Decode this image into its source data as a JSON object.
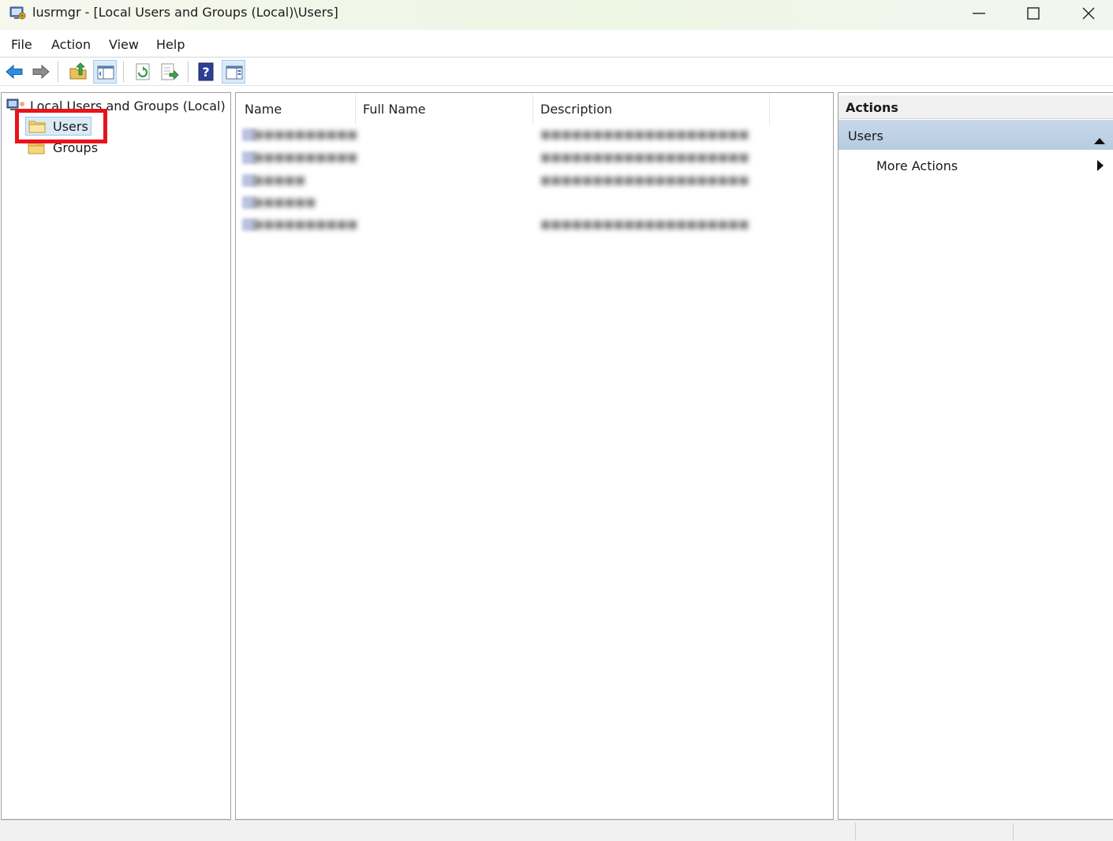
{
  "window": {
    "title": "lusrmgr - [Local Users and Groups (Local)\\Users]",
    "app_icon": "computer-management-icon"
  },
  "menubar": {
    "items": [
      {
        "label": "File"
      },
      {
        "label": "Action"
      },
      {
        "label": "View"
      },
      {
        "label": "Help"
      }
    ]
  },
  "toolbar": {
    "buttons": [
      {
        "icon": "back-arrow-icon"
      },
      {
        "icon": "forward-arrow-icon"
      },
      {
        "icon": "up-folder-icon"
      },
      {
        "icon": "show-hide-console-tree-icon",
        "selected": true
      },
      {
        "icon": "refresh-icon"
      },
      {
        "icon": "export-list-icon"
      },
      {
        "icon": "help-icon"
      },
      {
        "icon": "show-hide-action-pane-icon",
        "selected": true
      }
    ]
  },
  "tree": {
    "root": {
      "label": "Local Users and Groups (Local)",
      "icon": "computer-users-icon"
    },
    "nodes": [
      {
        "label": "Users",
        "icon": "folder-open-icon",
        "selected": true
      },
      {
        "label": "Groups",
        "icon": "folder-icon",
        "selected": false
      }
    ]
  },
  "list": {
    "columns": [
      {
        "label": "Name"
      },
      {
        "label": "Full Name"
      },
      {
        "label": "Description"
      }
    ],
    "rows_blurred": true
  },
  "actions": {
    "title": "Actions",
    "section": {
      "label": "Users",
      "expanded": true
    },
    "items": [
      {
        "label": "More Actions",
        "has_submenu": true
      }
    ]
  },
  "colors": {
    "highlight_box": "#e8131b",
    "selected_node_bg": "#dbeaf7",
    "actions_section_bg": "#b6cbe2"
  }
}
